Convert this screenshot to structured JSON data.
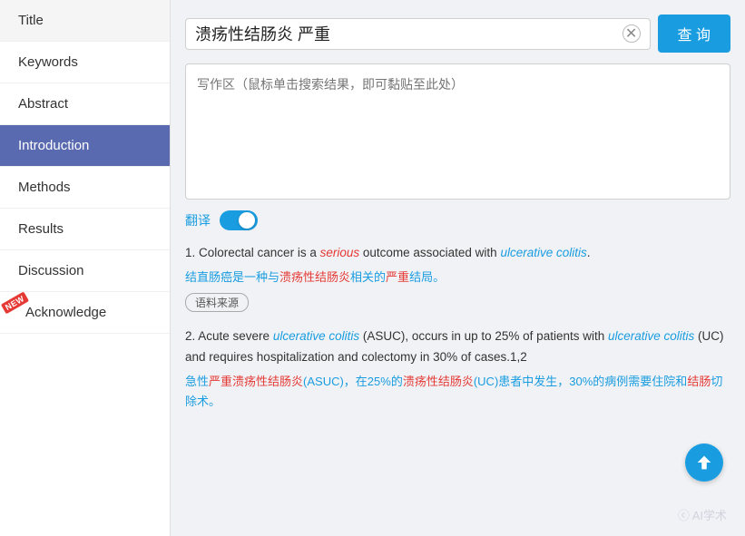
{
  "sidebar": {
    "items": [
      {
        "id": "title",
        "label": "Title",
        "active": false,
        "new": false
      },
      {
        "id": "keywords",
        "label": "Keywords",
        "active": false,
        "new": false
      },
      {
        "id": "abstract",
        "label": "Abstract",
        "active": false,
        "new": false
      },
      {
        "id": "introduction",
        "label": "Introduction",
        "active": true,
        "new": false
      },
      {
        "id": "methods",
        "label": "Methods",
        "active": false,
        "new": false
      },
      {
        "id": "results",
        "label": "Results",
        "active": false,
        "new": false
      },
      {
        "id": "discussion",
        "label": "Discussion",
        "active": false,
        "new": false
      },
      {
        "id": "acknowledge",
        "label": "Acknowledge",
        "active": false,
        "new": true
      }
    ]
  },
  "search": {
    "query": "溃疡性结肠炎 严重",
    "placeholder": "写作区（鼠标单击搜索结果，即可黏贴至此处）",
    "button_label": "查 询",
    "clear_title": "清除"
  },
  "translate": {
    "label": "翻译"
  },
  "results": [
    {
      "number": "1.",
      "en_before": "Colorectal cancer is a ",
      "en_keyword1_type": "red",
      "en_keyword1": "serious",
      "en_middle": " outcome associated with ",
      "en_keyword2_type": "blue",
      "en_keyword2": "ulcerative colitis",
      "en_after": ".",
      "zh_text": "结直肠癌是一种与溃疡性结肠炎相关的严重结局。",
      "zh_keyword_start": 9,
      "source_label": "语料来源"
    },
    {
      "number": "2.",
      "en_text_before": "Acute severe ",
      "en_k1_type": "blue",
      "en_k1": "ulcerative colitis",
      "en_text_mid": " (ASUC), occurs in up to 25% of patients wi\nth ",
      "en_k2_type": "blue",
      "en_k2": "ulcerative colitis",
      "en_text_after": " (UC) and requires hospitalization and colectomy in 3\n0% of cases.1,2",
      "zh_text": "急性严重溃疡性结肠炎(ASUC)，在25%的溃疡性结肠炎(UC)患者中发生，30%的\n病例需要住院和结肠切除术。"
    }
  ],
  "watermark": "ⓒ AI学术"
}
